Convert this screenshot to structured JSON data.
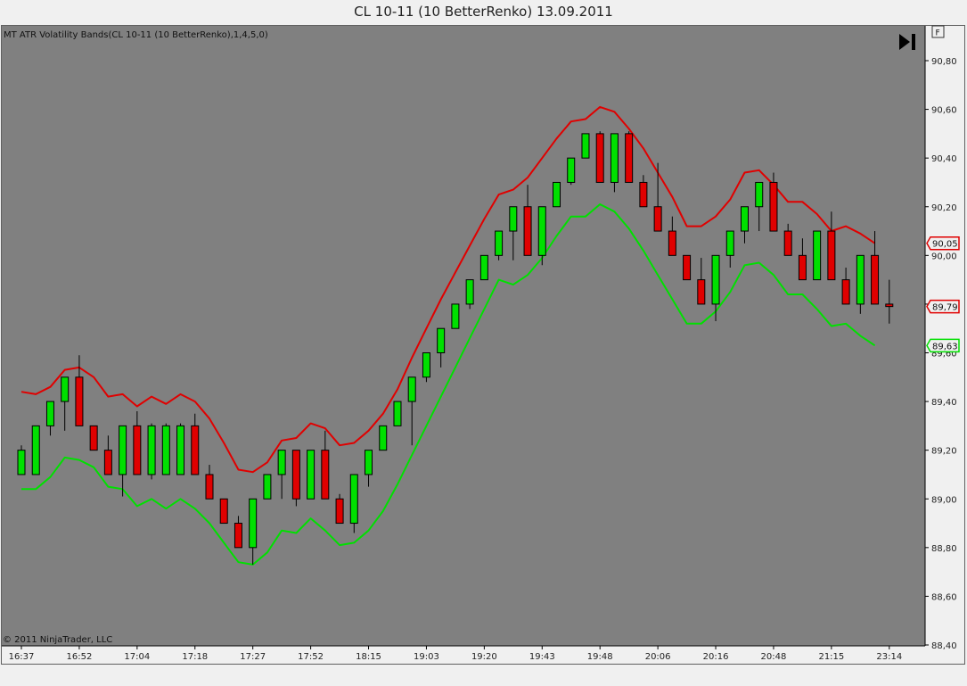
{
  "window": {
    "title": "CL 10-11 (10 BetterRenko)  13.09.2011"
  },
  "panel": {
    "indicator_label": "MT ATR Volatility Bands(CL 10-11 (10 BetterRenko),1,4,5,0)",
    "copyright": "© 2011 NinjaTrader, LLC",
    "f_button_label": "F",
    "go_end_icon": "skip-to-end-icon"
  },
  "colors": {
    "background": "#808080",
    "bull_candle": "#00e000",
    "bear_candle": "#e00000",
    "upper_band": "#e00000",
    "lower_band": "#00e000",
    "axis_bg": "#f0f0f0"
  },
  "chart_data": {
    "type": "candlestick",
    "ylim": [
      88.4,
      90.9
    ],
    "y_ticks": [
      "90,80",
      "90,60",
      "90,40",
      "90,20",
      "90,00",
      "89,80",
      "89,60",
      "89,40",
      "89,20",
      "89,00",
      "88,80",
      "88,60",
      "88,40"
    ],
    "x_tick_labels": [
      {
        "label": "16:37",
        "bar": 0
      },
      {
        "label": "16:52",
        "bar": 4
      },
      {
        "label": "17:04",
        "bar": 8
      },
      {
        "label": "17:18",
        "bar": 12
      },
      {
        "label": "17:27",
        "bar": 16
      },
      {
        "label": "17:52",
        "bar": 20
      },
      {
        "label": "18:15",
        "bar": 24
      },
      {
        "label": "19:03",
        "bar": 28
      },
      {
        "label": "19:20",
        "bar": 32
      },
      {
        "label": "19:43",
        "bar": 36
      },
      {
        "label": "19:48",
        "bar": 40
      },
      {
        "label": "20:06",
        "bar": 44
      },
      {
        "label": "20:16",
        "bar": 48
      },
      {
        "label": "20:48",
        "bar": 52
      },
      {
        "label": "21:15",
        "bar": 56
      },
      {
        "label": "23:14",
        "bar": 60
      }
    ],
    "candles": [
      {
        "o": 89.1,
        "h": 89.22,
        "l": 89.1,
        "c": 89.2
      },
      {
        "o": 89.1,
        "h": 89.3,
        "l": 89.1,
        "c": 89.3
      },
      {
        "o": 89.3,
        "h": 89.4,
        "l": 89.26,
        "c": 89.4
      },
      {
        "o": 89.4,
        "h": 89.5,
        "l": 89.28,
        "c": 89.5
      },
      {
        "o": 89.5,
        "h": 89.59,
        "l": 89.3,
        "c": 89.3
      },
      {
        "o": 89.3,
        "h": 89.3,
        "l": 89.2,
        "c": 89.2
      },
      {
        "o": 89.2,
        "h": 89.26,
        "l": 89.1,
        "c": 89.1
      },
      {
        "o": 89.1,
        "h": 89.3,
        "l": 89.01,
        "c": 89.3
      },
      {
        "o": 89.3,
        "h": 89.36,
        "l": 89.1,
        "c": 89.1
      },
      {
        "o": 89.1,
        "h": 89.31,
        "l": 89.08,
        "c": 89.3
      },
      {
        "o": 89.1,
        "h": 89.31,
        "l": 89.1,
        "c": 89.3
      },
      {
        "o": 89.1,
        "h": 89.31,
        "l": 89.1,
        "c": 89.3
      },
      {
        "o": 89.3,
        "h": 89.35,
        "l": 89.1,
        "c": 89.1
      },
      {
        "o": 89.1,
        "h": 89.14,
        "l": 89.0,
        "c": 89.0
      },
      {
        "o": 89.0,
        "h": 89.0,
        "l": 88.9,
        "c": 88.9
      },
      {
        "o": 88.9,
        "h": 88.93,
        "l": 88.8,
        "c": 88.8
      },
      {
        "o": 88.8,
        "h": 89.0,
        "l": 88.73,
        "c": 89.0
      },
      {
        "o": 89.0,
        "h": 89.1,
        "l": 89.0,
        "c": 89.1
      },
      {
        "o": 89.1,
        "h": 89.2,
        "l": 89.0,
        "c": 89.2
      },
      {
        "o": 89.2,
        "h": 89.2,
        "l": 88.97,
        "c": 89.0
      },
      {
        "o": 89.0,
        "h": 89.2,
        "l": 89.0,
        "c": 89.2
      },
      {
        "o": 89.2,
        "h": 89.28,
        "l": 89.0,
        "c": 89.0
      },
      {
        "o": 89.0,
        "h": 89.02,
        "l": 88.9,
        "c": 88.9
      },
      {
        "o": 88.9,
        "h": 89.1,
        "l": 88.86,
        "c": 89.1
      },
      {
        "o": 89.1,
        "h": 89.2,
        "l": 89.05,
        "c": 89.2
      },
      {
        "o": 89.2,
        "h": 89.3,
        "l": 89.2,
        "c": 89.3
      },
      {
        "o": 89.3,
        "h": 89.4,
        "l": 89.3,
        "c": 89.4
      },
      {
        "o": 89.4,
        "h": 89.5,
        "l": 89.22,
        "c": 89.5
      },
      {
        "o": 89.5,
        "h": 89.6,
        "l": 89.48,
        "c": 89.6
      },
      {
        "o": 89.6,
        "h": 89.7,
        "l": 89.54,
        "c": 89.7
      },
      {
        "o": 89.7,
        "h": 89.8,
        "l": 89.7,
        "c": 89.8
      },
      {
        "o": 89.8,
        "h": 89.9,
        "l": 89.78,
        "c": 89.9
      },
      {
        "o": 89.9,
        "h": 90.0,
        "l": 89.9,
        "c": 90.0
      },
      {
        "o": 90.0,
        "h": 90.1,
        "l": 89.98,
        "c": 90.1
      },
      {
        "o": 90.1,
        "h": 90.2,
        "l": 89.98,
        "c": 90.2
      },
      {
        "o": 90.2,
        "h": 90.29,
        "l": 90.0,
        "c": 90.0
      },
      {
        "o": 90.0,
        "h": 90.2,
        "l": 89.96,
        "c": 90.2
      },
      {
        "o": 90.2,
        "h": 90.3,
        "l": 90.2,
        "c": 90.3
      },
      {
        "o": 90.3,
        "h": 90.4,
        "l": 90.29,
        "c": 90.4
      },
      {
        "o": 90.4,
        "h": 90.5,
        "l": 90.4,
        "c": 90.5
      },
      {
        "o": 90.5,
        "h": 90.51,
        "l": 90.3,
        "c": 90.3
      },
      {
        "o": 90.3,
        "h": 90.5,
        "l": 90.26,
        "c": 90.5
      },
      {
        "o": 90.5,
        "h": 90.51,
        "l": 90.3,
        "c": 90.3
      },
      {
        "o": 90.3,
        "h": 90.33,
        "l": 90.2,
        "c": 90.2
      },
      {
        "o": 90.2,
        "h": 90.38,
        "l": 90.1,
        "c": 90.1
      },
      {
        "o": 90.1,
        "h": 90.16,
        "l": 90.0,
        "c": 90.0
      },
      {
        "o": 90.0,
        "h": 90.0,
        "l": 89.9,
        "c": 89.9
      },
      {
        "o": 89.9,
        "h": 89.99,
        "l": 89.8,
        "c": 89.8
      },
      {
        "o": 89.8,
        "h": 90.0,
        "l": 89.73,
        "c": 90.0
      },
      {
        "o": 90.0,
        "h": 90.1,
        "l": 89.95,
        "c": 90.1
      },
      {
        "o": 90.1,
        "h": 90.2,
        "l": 90.05,
        "c": 90.2
      },
      {
        "o": 90.2,
        "h": 90.3,
        "l": 90.1,
        "c": 90.3
      },
      {
        "o": 90.3,
        "h": 90.34,
        "l": 90.1,
        "c": 90.1
      },
      {
        "o": 90.1,
        "h": 90.13,
        "l": 90.0,
        "c": 90.0
      },
      {
        "o": 90.0,
        "h": 90.07,
        "l": 89.9,
        "c": 89.9
      },
      {
        "o": 89.9,
        "h": 90.1,
        "l": 89.9,
        "c": 90.1
      },
      {
        "o": 90.1,
        "h": 90.18,
        "l": 89.9,
        "c": 89.9
      },
      {
        "o": 89.9,
        "h": 89.95,
        "l": 89.8,
        "c": 89.8
      },
      {
        "o": 89.8,
        "h": 90.0,
        "l": 89.76,
        "c": 90.0
      },
      {
        "o": 90.0,
        "h": 90.1,
        "l": 89.8,
        "c": 89.8
      },
      {
        "o": 89.8,
        "h": 89.9,
        "l": 89.72,
        "c": 89.79
      }
    ],
    "series": [
      {
        "values": [
          89.44,
          89.43,
          89.46,
          89.53,
          89.54,
          89.5,
          89.42,
          89.43,
          89.38,
          89.42,
          89.39,
          89.43,
          89.4,
          89.33,
          89.23,
          89.12,
          89.11,
          89.15,
          89.24,
          89.25,
          89.31,
          89.29,
          89.22,
          89.23,
          89.28,
          89.35,
          89.45,
          89.58,
          89.7,
          89.82,
          89.93,
          90.04,
          90.15,
          90.25,
          90.27,
          90.32,
          90.4,
          90.48,
          90.55,
          90.56,
          90.61,
          90.59,
          90.52,
          90.44,
          90.34,
          90.24,
          90.12,
          90.12,
          90.16,
          90.23,
          90.34,
          90.35,
          90.29,
          90.22,
          90.22,
          90.17,
          90.1,
          90.12,
          90.09,
          90.05
        ]
      },
      {
        "values": [
          89.04,
          89.04,
          89.09,
          89.17,
          89.16,
          89.13,
          89.05,
          89.04,
          88.97,
          89.0,
          88.96,
          89.0,
          88.96,
          88.9,
          88.82,
          88.74,
          88.73,
          88.78,
          88.87,
          88.86,
          88.92,
          88.87,
          88.81,
          88.82,
          88.87,
          88.95,
          89.06,
          89.18,
          89.3,
          89.42,
          89.54,
          89.66,
          89.78,
          89.9,
          89.88,
          89.92,
          89.99,
          90.08,
          90.16,
          90.16,
          90.21,
          90.18,
          90.11,
          90.02,
          89.92,
          89.82,
          89.72,
          89.72,
          89.77,
          89.85,
          89.96,
          89.97,
          89.92,
          89.84,
          89.84,
          89.78,
          89.71,
          89.72,
          89.67,
          89.63
        ]
      }
    ],
    "price_markers": [
      {
        "label": "90,05",
        "value": 90.05,
        "color": "upper_band"
      },
      {
        "label": "89,79",
        "value": 89.79,
        "color": "bear_candle"
      },
      {
        "label": "89,63",
        "value": 89.63,
        "color": "lower_band"
      }
    ]
  }
}
